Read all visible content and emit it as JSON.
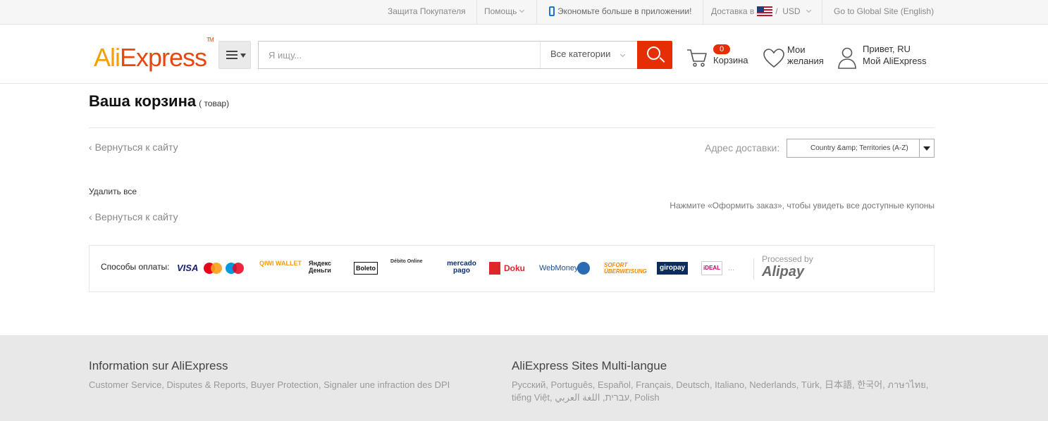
{
  "topbar": {
    "buyer_protection": "Защита Покупателя",
    "help": "Помощь",
    "app_promo": "Экономьте больше в приложении!",
    "ship_to_label": "Доставка в",
    "currency_sep": "/",
    "currency": "USD",
    "global_site": "Go to Global Site (English)"
  },
  "header": {
    "logo_ali": "Ali",
    "logo_express": "Express",
    "logo_tm": "TM",
    "search_placeholder": "Я ищу...",
    "category": "Все категории",
    "cart_count": "0",
    "cart_label": "Корзина",
    "wish_line1": "Мои",
    "wish_line2": "желания",
    "account_line1": "Привет, RU",
    "account_line2": "Мой AliExpress"
  },
  "cart": {
    "title": "Ваша корзина",
    "count_text": "( товар)",
    "back_link": "Вернуться к сайту",
    "ship_label": "Адрес доставки:",
    "ship_value": "Country &amp; Territories (A-Z)",
    "delete_all": "Удалить все",
    "coupon_hint": "Нажмите «Оформить заказ», чтобы увидеть все доступные купоны"
  },
  "payments": {
    "label": "Способы оплаты:",
    "methods": [
      "VISA",
      "MasterCard",
      "Maestro",
      "QIWI WALLET",
      "Яндекс Деньги",
      "Boleto",
      "Débito Online",
      "mercado pago",
      "Doku",
      "WebMoney",
      "SOFORT ÜBERWEISUNG",
      "giropay",
      "iDEAL",
      "..."
    ],
    "processed_by": "Processed by",
    "alipay": "Alipay"
  },
  "footer": {
    "info_title": "Information sur AliExpress",
    "info_links": "Customer Service, Disputes & Reports, Buyer Protection, Signaler une infraction des DPI",
    "sites_title": "AliExpress Sites Multi-langue",
    "sites_links": "Русский, Português, Español, Français, Deutsch, Italiano, Nederlands, Türk, 日本語, 한국어, ภาษาไทย, tiếng Việt, עברית, اللغة العربي, Polish"
  },
  "colors": {
    "brand_orange": "#f6a000",
    "brand_red": "#e8470f",
    "search_button": "#e62e04",
    "footer_bg": "#e8e8e8"
  }
}
